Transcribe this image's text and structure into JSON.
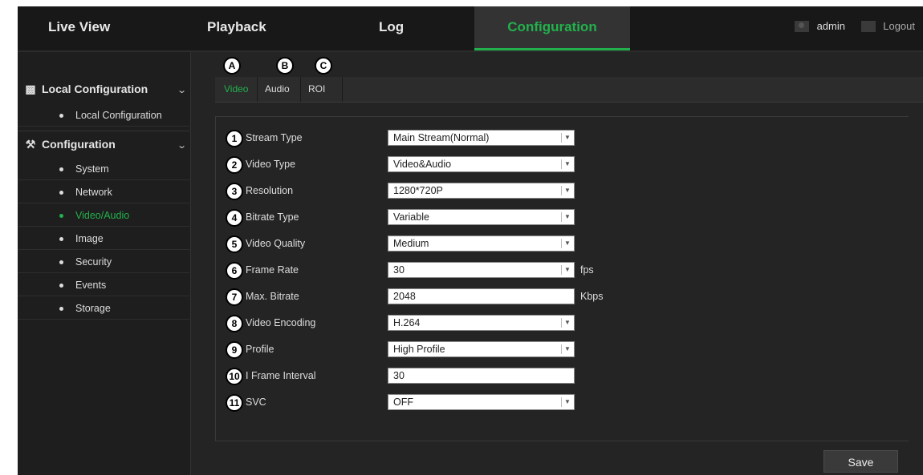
{
  "nav": {
    "tabs": [
      "Live View",
      "Playback",
      "Log",
      "Configuration"
    ],
    "active": "Configuration",
    "user": "admin",
    "logout": "Logout"
  },
  "sidebar": {
    "local_section": "Local Configuration",
    "local_items": [
      "Local Configuration"
    ],
    "config_section": "Configuration",
    "config_items": [
      "System",
      "Network",
      "Video/Audio",
      "Image",
      "Security",
      "Events",
      "Storage"
    ],
    "active_item": "Video/Audio"
  },
  "tabs": {
    "items": [
      "Video",
      "Audio",
      "ROI"
    ],
    "active": "Video",
    "callouts": [
      "A",
      "B",
      "C"
    ]
  },
  "form": {
    "fields": [
      {
        "num": "1",
        "label": "Stream Type",
        "value": "Main Stream(Normal)",
        "type": "select",
        "unit": ""
      },
      {
        "num": "2",
        "label": "Video Type",
        "value": "Video&Audio",
        "type": "select",
        "unit": ""
      },
      {
        "num": "3",
        "label": "Resolution",
        "value": "1280*720P",
        "type": "select",
        "unit": ""
      },
      {
        "num": "4",
        "label": "Bitrate Type",
        "value": "Variable",
        "type": "select",
        "unit": ""
      },
      {
        "num": "5",
        "label": "Video Quality",
        "value": "Medium",
        "type": "select",
        "unit": ""
      },
      {
        "num": "6",
        "label": "Frame Rate",
        "value": "30",
        "type": "select",
        "unit": "fps"
      },
      {
        "num": "7",
        "label": "Max. Bitrate",
        "value": "2048",
        "type": "input",
        "unit": "Kbps"
      },
      {
        "num": "8",
        "label": "Video Encoding",
        "value": "H.264",
        "type": "select",
        "unit": ""
      },
      {
        "num": "9",
        "label": "Profile",
        "value": "High Profile",
        "type": "select",
        "unit": ""
      },
      {
        "num": "10",
        "label": "I Frame Interval",
        "value": "30",
        "type": "input",
        "unit": ""
      },
      {
        "num": "11",
        "label": "SVC",
        "value": "OFF",
        "type": "select",
        "unit": ""
      }
    ]
  },
  "save_label": "Save",
  "colors": {
    "accent": "#22b14c",
    "background": "#242424"
  }
}
